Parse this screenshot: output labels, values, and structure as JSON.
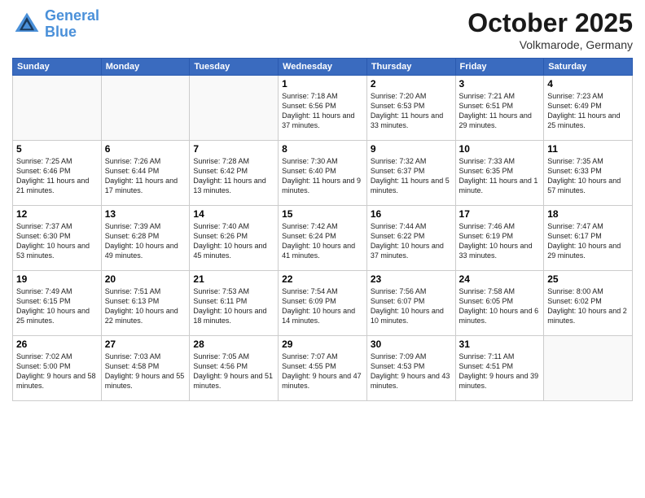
{
  "header": {
    "logo_line1": "General",
    "logo_line2": "Blue",
    "month": "October 2025",
    "location": "Volkmarode, Germany"
  },
  "weekdays": [
    "Sunday",
    "Monday",
    "Tuesday",
    "Wednesday",
    "Thursday",
    "Friday",
    "Saturday"
  ],
  "weeks": [
    [
      {
        "day": "",
        "sunrise": "",
        "sunset": "",
        "daylight": ""
      },
      {
        "day": "",
        "sunrise": "",
        "sunset": "",
        "daylight": ""
      },
      {
        "day": "",
        "sunrise": "",
        "sunset": "",
        "daylight": ""
      },
      {
        "day": "1",
        "sunrise": "Sunrise: 7:18 AM",
        "sunset": "Sunset: 6:56 PM",
        "daylight": "Daylight: 11 hours and 37 minutes."
      },
      {
        "day": "2",
        "sunrise": "Sunrise: 7:20 AM",
        "sunset": "Sunset: 6:53 PM",
        "daylight": "Daylight: 11 hours and 33 minutes."
      },
      {
        "day": "3",
        "sunrise": "Sunrise: 7:21 AM",
        "sunset": "Sunset: 6:51 PM",
        "daylight": "Daylight: 11 hours and 29 minutes."
      },
      {
        "day": "4",
        "sunrise": "Sunrise: 7:23 AM",
        "sunset": "Sunset: 6:49 PM",
        "daylight": "Daylight: 11 hours and 25 minutes."
      }
    ],
    [
      {
        "day": "5",
        "sunrise": "Sunrise: 7:25 AM",
        "sunset": "Sunset: 6:46 PM",
        "daylight": "Daylight: 11 hours and 21 minutes."
      },
      {
        "day": "6",
        "sunrise": "Sunrise: 7:26 AM",
        "sunset": "Sunset: 6:44 PM",
        "daylight": "Daylight: 11 hours and 17 minutes."
      },
      {
        "day": "7",
        "sunrise": "Sunrise: 7:28 AM",
        "sunset": "Sunset: 6:42 PM",
        "daylight": "Daylight: 11 hours and 13 minutes."
      },
      {
        "day": "8",
        "sunrise": "Sunrise: 7:30 AM",
        "sunset": "Sunset: 6:40 PM",
        "daylight": "Daylight: 11 hours and 9 minutes."
      },
      {
        "day": "9",
        "sunrise": "Sunrise: 7:32 AM",
        "sunset": "Sunset: 6:37 PM",
        "daylight": "Daylight: 11 hours and 5 minutes."
      },
      {
        "day": "10",
        "sunrise": "Sunrise: 7:33 AM",
        "sunset": "Sunset: 6:35 PM",
        "daylight": "Daylight: 11 hours and 1 minute."
      },
      {
        "day": "11",
        "sunrise": "Sunrise: 7:35 AM",
        "sunset": "Sunset: 6:33 PM",
        "daylight": "Daylight: 10 hours and 57 minutes."
      }
    ],
    [
      {
        "day": "12",
        "sunrise": "Sunrise: 7:37 AM",
        "sunset": "Sunset: 6:30 PM",
        "daylight": "Daylight: 10 hours and 53 minutes."
      },
      {
        "day": "13",
        "sunrise": "Sunrise: 7:39 AM",
        "sunset": "Sunset: 6:28 PM",
        "daylight": "Daylight: 10 hours and 49 minutes."
      },
      {
        "day": "14",
        "sunrise": "Sunrise: 7:40 AM",
        "sunset": "Sunset: 6:26 PM",
        "daylight": "Daylight: 10 hours and 45 minutes."
      },
      {
        "day": "15",
        "sunrise": "Sunrise: 7:42 AM",
        "sunset": "Sunset: 6:24 PM",
        "daylight": "Daylight: 10 hours and 41 minutes."
      },
      {
        "day": "16",
        "sunrise": "Sunrise: 7:44 AM",
        "sunset": "Sunset: 6:22 PM",
        "daylight": "Daylight: 10 hours and 37 minutes."
      },
      {
        "day": "17",
        "sunrise": "Sunrise: 7:46 AM",
        "sunset": "Sunset: 6:19 PM",
        "daylight": "Daylight: 10 hours and 33 minutes."
      },
      {
        "day": "18",
        "sunrise": "Sunrise: 7:47 AM",
        "sunset": "Sunset: 6:17 PM",
        "daylight": "Daylight: 10 hours and 29 minutes."
      }
    ],
    [
      {
        "day": "19",
        "sunrise": "Sunrise: 7:49 AM",
        "sunset": "Sunset: 6:15 PM",
        "daylight": "Daylight: 10 hours and 25 minutes."
      },
      {
        "day": "20",
        "sunrise": "Sunrise: 7:51 AM",
        "sunset": "Sunset: 6:13 PM",
        "daylight": "Daylight: 10 hours and 22 minutes."
      },
      {
        "day": "21",
        "sunrise": "Sunrise: 7:53 AM",
        "sunset": "Sunset: 6:11 PM",
        "daylight": "Daylight: 10 hours and 18 minutes."
      },
      {
        "day": "22",
        "sunrise": "Sunrise: 7:54 AM",
        "sunset": "Sunset: 6:09 PM",
        "daylight": "Daylight: 10 hours and 14 minutes."
      },
      {
        "day": "23",
        "sunrise": "Sunrise: 7:56 AM",
        "sunset": "Sunset: 6:07 PM",
        "daylight": "Daylight: 10 hours and 10 minutes."
      },
      {
        "day": "24",
        "sunrise": "Sunrise: 7:58 AM",
        "sunset": "Sunset: 6:05 PM",
        "daylight": "Daylight: 10 hours and 6 minutes."
      },
      {
        "day": "25",
        "sunrise": "Sunrise: 8:00 AM",
        "sunset": "Sunset: 6:02 PM",
        "daylight": "Daylight: 10 hours and 2 minutes."
      }
    ],
    [
      {
        "day": "26",
        "sunrise": "Sunrise: 7:02 AM",
        "sunset": "Sunset: 5:00 PM",
        "daylight": "Daylight: 9 hours and 58 minutes."
      },
      {
        "day": "27",
        "sunrise": "Sunrise: 7:03 AM",
        "sunset": "Sunset: 4:58 PM",
        "daylight": "Daylight: 9 hours and 55 minutes."
      },
      {
        "day": "28",
        "sunrise": "Sunrise: 7:05 AM",
        "sunset": "Sunset: 4:56 PM",
        "daylight": "Daylight: 9 hours and 51 minutes."
      },
      {
        "day": "29",
        "sunrise": "Sunrise: 7:07 AM",
        "sunset": "Sunset: 4:55 PM",
        "daylight": "Daylight: 9 hours and 47 minutes."
      },
      {
        "day": "30",
        "sunrise": "Sunrise: 7:09 AM",
        "sunset": "Sunset: 4:53 PM",
        "daylight": "Daylight: 9 hours and 43 minutes."
      },
      {
        "day": "31",
        "sunrise": "Sunrise: 7:11 AM",
        "sunset": "Sunset: 4:51 PM",
        "daylight": "Daylight: 9 hours and 39 minutes."
      },
      {
        "day": "",
        "sunrise": "",
        "sunset": "",
        "daylight": ""
      }
    ]
  ]
}
